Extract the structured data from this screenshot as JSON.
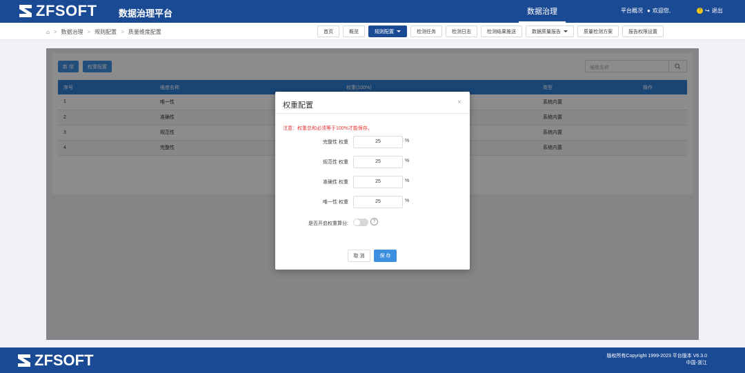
{
  "header": {
    "logo": "ZFSOFT",
    "platform_name": "数据治理平台",
    "active_menu": "数据治理",
    "overview": "平台概况",
    "welcome": "欢迎您,",
    "logout": "退出"
  },
  "breadcrumb": [
    "数据治理",
    "规则配置",
    "质量维度配置"
  ],
  "nav_buttons": {
    "home": "首页",
    "overview": "概览",
    "rule_config": "规则配置",
    "check_task": "检测任务",
    "check_log": "检测日志",
    "result_push": "检测结果推送",
    "quality_report": "数据质量报告",
    "quality_plan": "质量检测方案",
    "report_permission": "报告权限设置"
  },
  "toolbar": {
    "add": "新 增",
    "weight_config": "权重配置",
    "search_placeholder": "维度名称"
  },
  "table": {
    "headers": [
      "序号",
      "维度名称",
      "权重(100%)",
      "类型",
      "操作"
    ],
    "rows": [
      [
        "1",
        "唯一性",
        "",
        "系统内置",
        ""
      ],
      [
        "2",
        "准确性",
        "",
        "系统内置",
        ""
      ],
      [
        "3",
        "规范性",
        "",
        "系统内置",
        ""
      ],
      [
        "4",
        "完整性",
        "",
        "系统内置",
        ""
      ]
    ]
  },
  "modal": {
    "title": "权重配置",
    "close": "×",
    "note": "注意：权重总和必须等于100%才能保存。",
    "fields": [
      {
        "label": "完整性 权重",
        "value": "25",
        "unit": "%"
      },
      {
        "label": "规范性 权重",
        "value": "25",
        "unit": "%"
      },
      {
        "label": "准确性 权重",
        "value": "25",
        "unit": "%"
      },
      {
        "label": "唯一性 权重",
        "value": "25",
        "unit": "%"
      }
    ],
    "toggle_label": "是否开启权重算分:",
    "help": "?",
    "cancel": "取 消",
    "save": "保 存"
  },
  "footer": {
    "logo": "ZFSOFT",
    "copyright": "版权所有Copyright 1999-2023 平台版本 V6.3.0",
    "region": "中国-浙江"
  },
  "colors": {
    "brand": "#1b4a94",
    "primary_button": "#3d8fe0",
    "table_header": "#2e7fd4",
    "warning": "#e53333"
  }
}
